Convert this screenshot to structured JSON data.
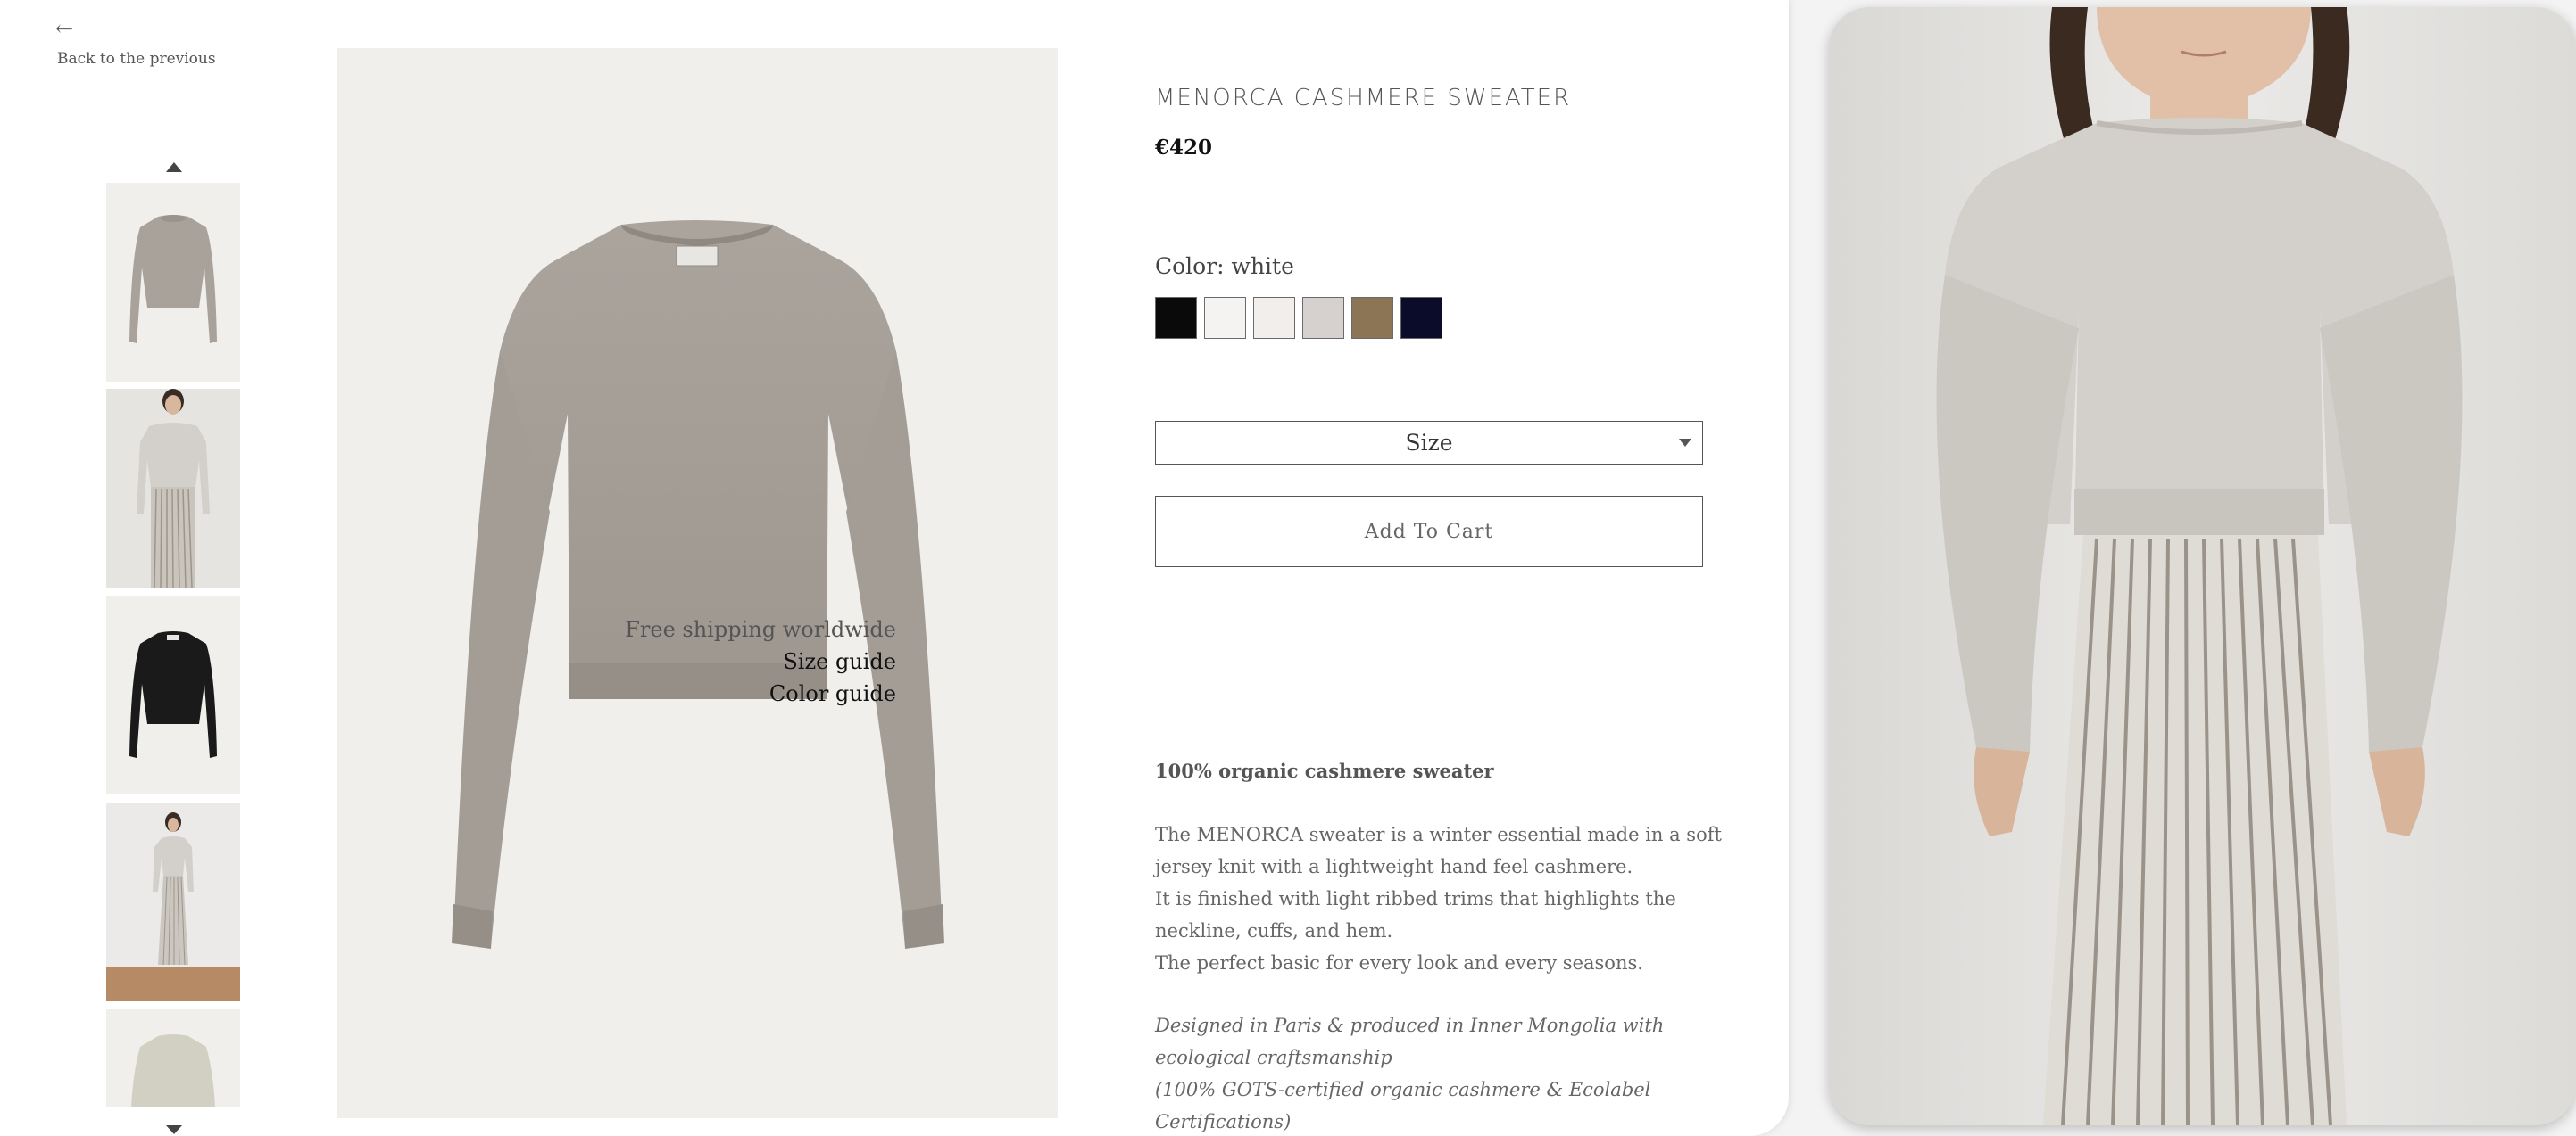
{
  "nav": {
    "back_arrow": "←",
    "back_label": "Back to the previous"
  },
  "product": {
    "title": "MENORCA CASHMERE SWEATER",
    "price": "€420",
    "color_label": "Color: white",
    "swatches": [
      {
        "name": "black",
        "color": "#0a0a0a"
      },
      {
        "name": "white",
        "color": "#f5f3f2"
      },
      {
        "name": "ivory",
        "color": "#f1eeeb"
      },
      {
        "name": "light-grey",
        "color": "#d6d1cf"
      },
      {
        "name": "camel",
        "color": "#8b7555"
      },
      {
        "name": "navy",
        "color": "#0b0c2a"
      }
    ],
    "size_placeholder": "Size",
    "add_to_cart": "Add To Cart"
  },
  "info": {
    "shipping": "Free shipping worldwide",
    "size_guide": "Size guide",
    "color_guide": "Color guide"
  },
  "description": {
    "heading": "100% organic cashmere sweater",
    "lines": [
      "The MENORCA sweater is a winter essential made in a soft",
      "jersey knit with a lightweight hand feel cashmere.",
      "It is finished with light ribbed trims that highlights the",
      "neckline, cuffs, and hem.",
      "The perfect basic for every look and every seasons."
    ],
    "italic_lines": [
      "Designed in Paris & produced in Inner Mongolia with",
      "ecological craftsmanship",
      "(100% GOTS-certified organic cashmere & Ecolabel",
      "Certifications)"
    ]
  },
  "colors": {
    "sweater_grey": "#a8a29b",
    "sweater_light": "#d3cfca",
    "sweater_black": "#1a1a1a"
  }
}
